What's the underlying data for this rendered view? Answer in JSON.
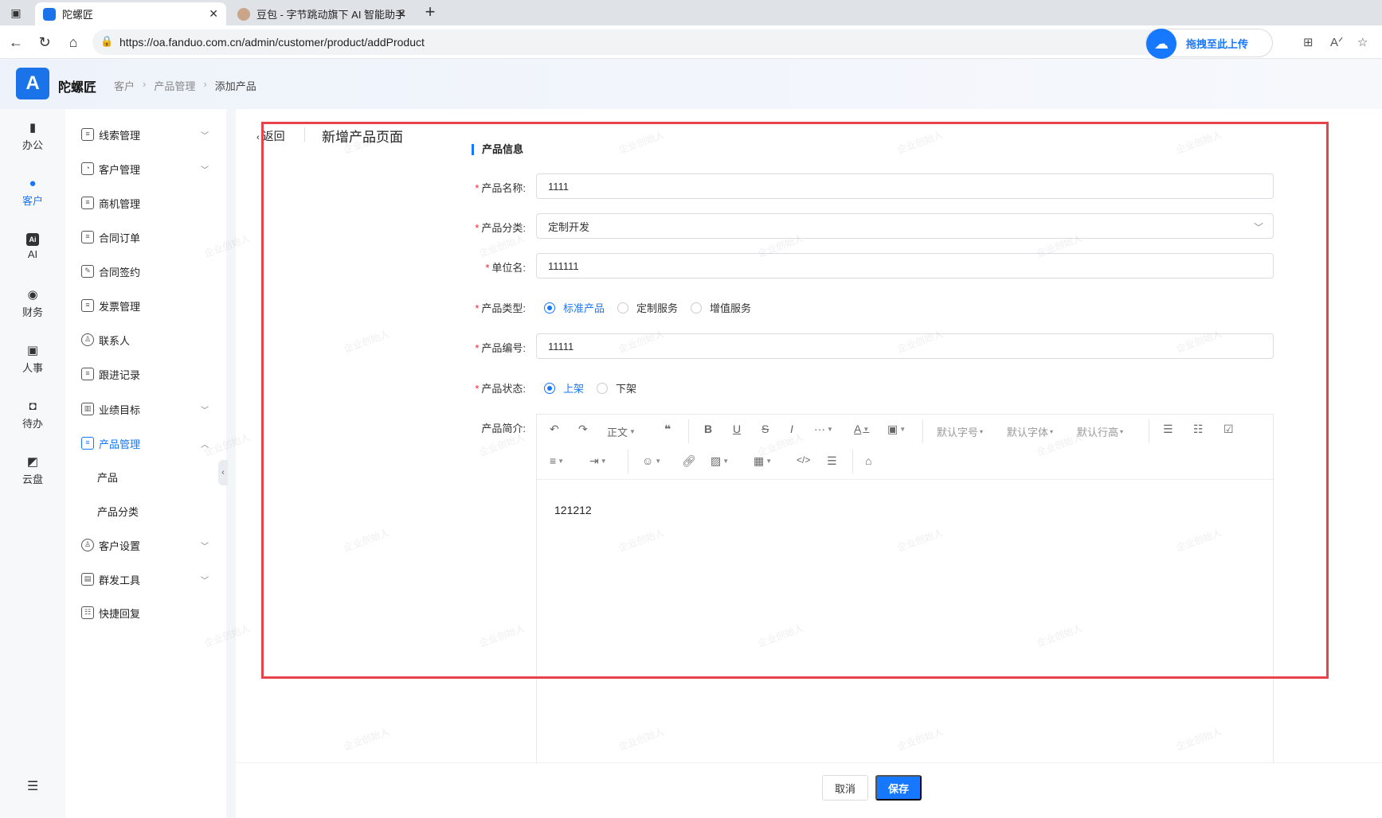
{
  "browser": {
    "tabs": [
      {
        "label": "陀螺匠",
        "active": true
      },
      {
        "label": "豆包 - 字节跳动旗下 AI 智能助手",
        "active": false
      }
    ],
    "new_tab": "+",
    "url": "https://oa.fanduo.com.cn/admin/customer/product/addProduct",
    "drag_upload_label": "拖拽至此上传"
  },
  "app": {
    "name": "陀螺匠",
    "breadcrumb": [
      "客户",
      "产品管理",
      "添加产品"
    ]
  },
  "rail": [
    {
      "label": "办公",
      "icon": "briefcase-icon",
      "active": false
    },
    {
      "label": "客户",
      "icon": "customer-icon",
      "active": true
    },
    {
      "label": "AI",
      "icon": "ai-icon",
      "active": false
    },
    {
      "label": "财务",
      "icon": "money-bag-icon",
      "active": false
    },
    {
      "label": "人事",
      "icon": "badge-icon",
      "active": false
    },
    {
      "label": "待办",
      "icon": "todo-icon",
      "active": false
    },
    {
      "label": "云盘",
      "icon": "cloud-disk-icon",
      "active": false
    }
  ],
  "menu": [
    {
      "label": "线索管理",
      "chevron": "down"
    },
    {
      "label": "客户管理",
      "chevron": "down"
    },
    {
      "label": "商机管理",
      "chevron": ""
    },
    {
      "label": "合同订单",
      "chevron": ""
    },
    {
      "label": "合同签约",
      "chevron": ""
    },
    {
      "label": "发票管理",
      "chevron": ""
    },
    {
      "label": "联系人",
      "chevron": ""
    },
    {
      "label": "跟进记录",
      "chevron": ""
    },
    {
      "label": "业绩目标",
      "chevron": "down"
    },
    {
      "label": "产品管理",
      "chevron": "up",
      "active": true
    },
    {
      "label": "产品",
      "sub": true
    },
    {
      "label": "产品分类",
      "sub": true
    },
    {
      "label": "客户设置",
      "chevron": "down"
    },
    {
      "label": "群发工具",
      "chevron": "down"
    },
    {
      "label": "快捷回复",
      "chevron": ""
    }
  ],
  "page": {
    "back_label": "返回",
    "title": "新增产品页面",
    "section_title": "产品信息"
  },
  "form": {
    "name_label": "产品名称:",
    "name_value": "1111",
    "category_label": "产品分类:",
    "category_value": "定制开发",
    "unit_label": "单位名:",
    "unit_value": "111111",
    "type_label": "产品类型:",
    "type_options": [
      "标准产品",
      "定制服务",
      "增值服务"
    ],
    "type_selected": "标准产品",
    "code_label": "产品编号:",
    "code_value": "11111",
    "status_label": "产品状态:",
    "status_options": [
      "上架",
      "下架"
    ],
    "status_selected": "上架",
    "intro_label": "产品简介:",
    "intro_value": "121212"
  },
  "editor": {
    "paragraph": "正文",
    "font_size": "默认字号",
    "font_family": "默认字体",
    "line_height": "默认行高"
  },
  "actions": {
    "cancel": "取消",
    "save": "保存"
  },
  "watermark": "企业创始人",
  "colors": {
    "accent": "#1677ff",
    "required": "#f5222d",
    "highlight_box": "#e8424a"
  }
}
